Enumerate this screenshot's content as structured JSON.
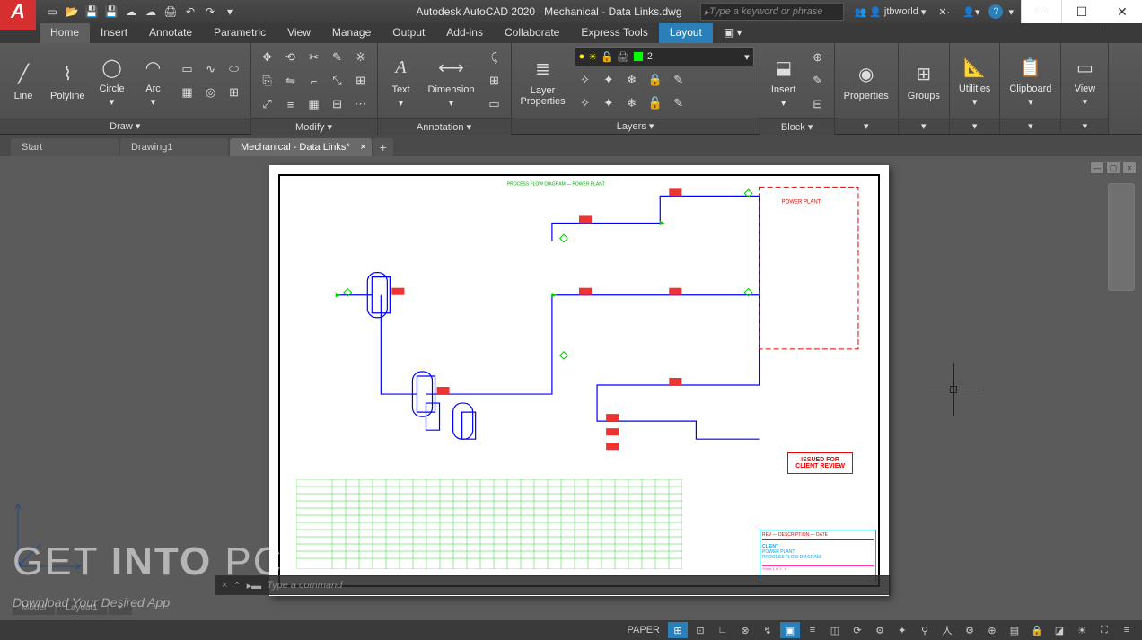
{
  "app": {
    "title": "Autodesk AutoCAD 2020",
    "document": "Mechanical - Data Links.dwg",
    "search_placeholder": "Type a keyword or phrase",
    "user": "jtbworld"
  },
  "ribbon_tabs": [
    "Home",
    "Insert",
    "Annotate",
    "Parametric",
    "View",
    "Manage",
    "Output",
    "Add-ins",
    "Collaborate",
    "Express Tools",
    "Layout"
  ],
  "ribbon": {
    "draw": {
      "title": "Draw ▾",
      "items": [
        "Line",
        "Polyline",
        "Circle",
        "Arc"
      ]
    },
    "modify": {
      "title": "Modify ▾"
    },
    "annotation": {
      "title": "Annotation ▾",
      "text": "Text",
      "dimension": "Dimension"
    },
    "layers": {
      "title": "Layers ▾",
      "btn": "Layer\nProperties",
      "current": "2"
    },
    "block": {
      "title": "Block ▾",
      "btn": "Insert"
    },
    "properties": {
      "title": "▾",
      "btn": "Properties"
    },
    "groups": {
      "title": "▾",
      "btn": "Groups"
    },
    "utilities": {
      "title": "Utilities",
      "btn": ""
    },
    "clipboard": {
      "title": "Clipboard",
      "btn": ""
    },
    "view": {
      "title": "▾",
      "btn": "View"
    }
  },
  "file_tabs": [
    "Start",
    "Drawing1",
    "Mechanical - Data Links*"
  ],
  "layout_tabs": [
    "Model",
    "Layout1"
  ],
  "command_placeholder": "Type a command",
  "status": {
    "space": "PAPER"
  },
  "stamp": {
    "line1": "ISSUED FOR",
    "line2": "CLIENT REVIEW"
  },
  "titleblock": {
    "line1": "CLIENT",
    "line2": "POWER PLANT",
    "line3": "PROCESS FLOW DIAGRAM"
  },
  "annotation_label": "POWER PLANT",
  "watermark": {
    "get": "GET ",
    "into": "INTO ",
    "pc": "PC"
  },
  "subtext": "Download Your Desired App"
}
